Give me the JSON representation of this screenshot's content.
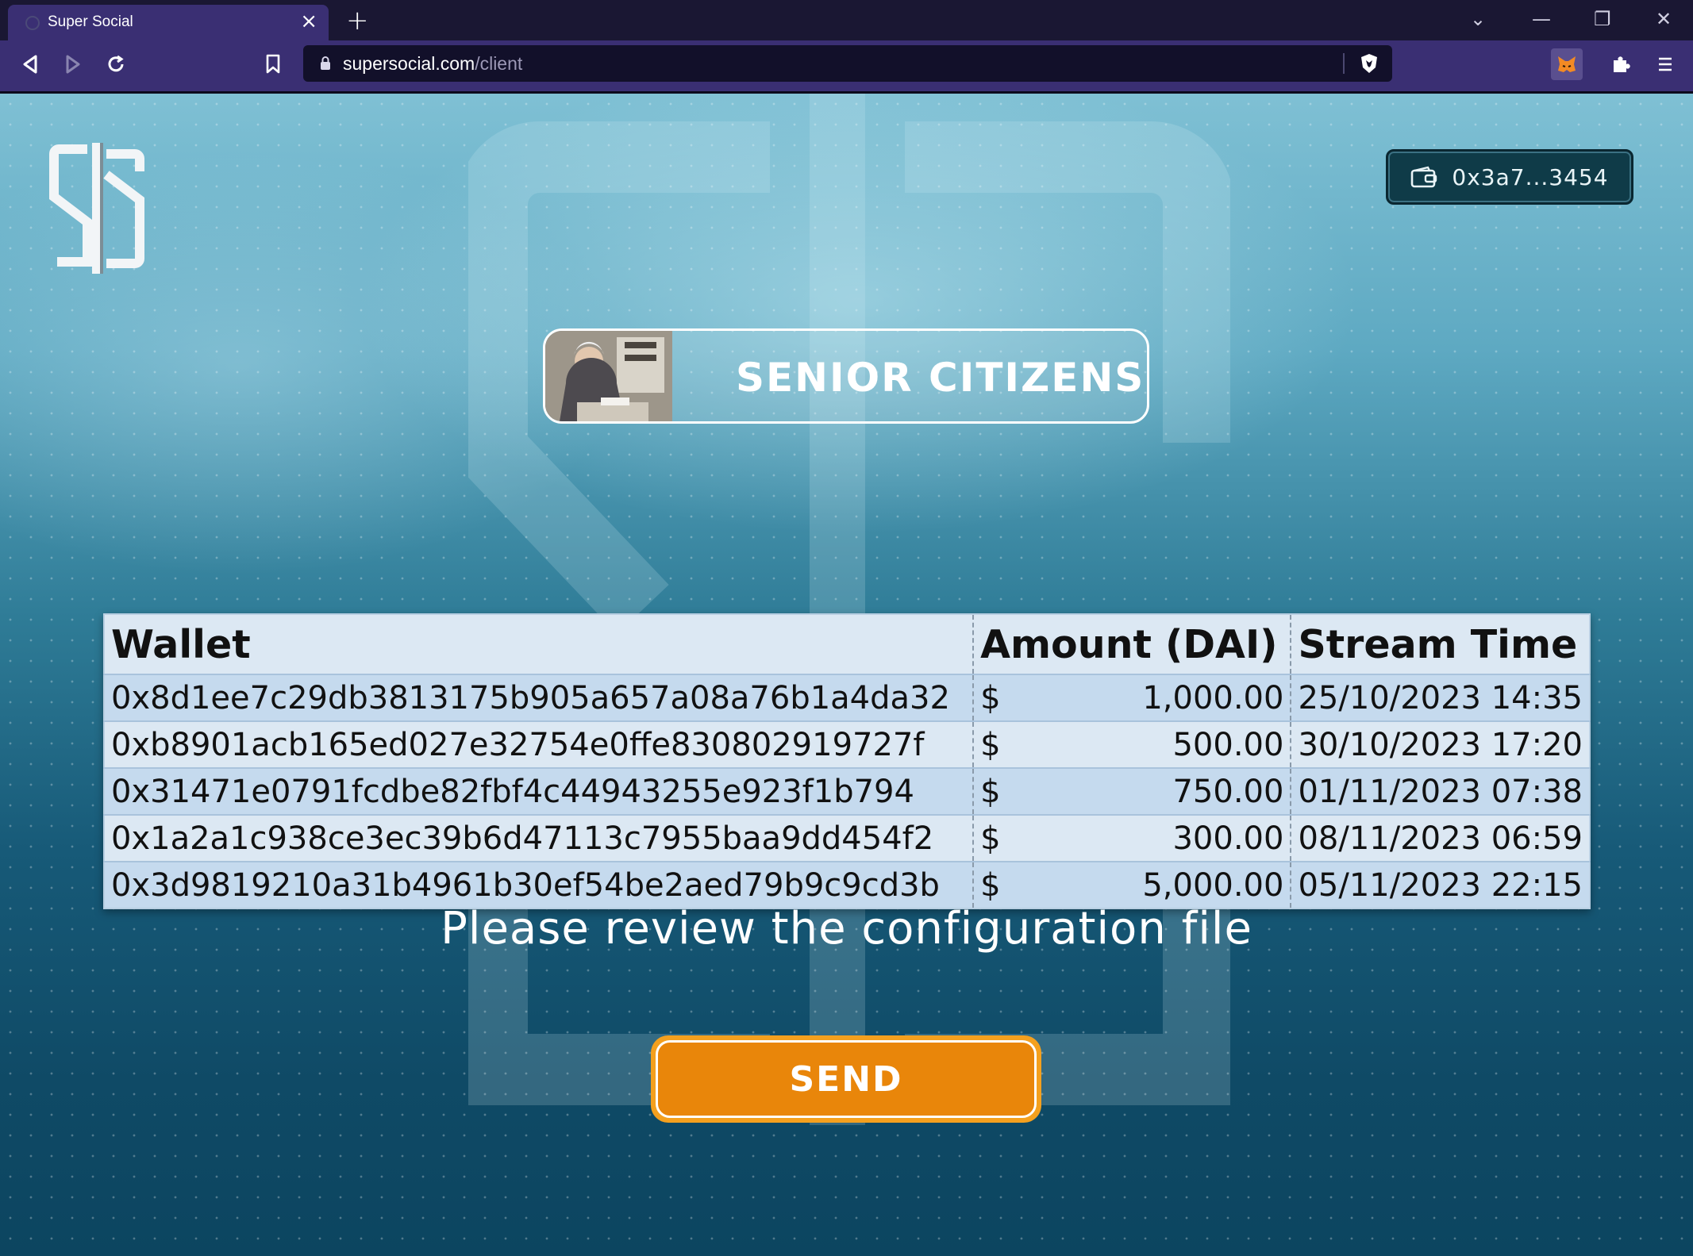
{
  "browser": {
    "tab_title": "Super Social",
    "url_host": "supersocial.com",
    "url_path": "/client"
  },
  "header": {
    "wallet_address": "0x3a7...3454"
  },
  "category": {
    "label": "SENIOR CITIZENS"
  },
  "table": {
    "headers": [
      "Wallet",
      "Amount (DAI)",
      "Stream Time"
    ],
    "currency_symbol": "$",
    "rows": [
      {
        "wallet": "0x8d1ee7c29db3813175b905a657a08a76b1a4da32",
        "amount": "1,000.00",
        "time": "25/10/2023 14:35"
      },
      {
        "wallet": "0xb8901acb165ed027e32754e0ffe830802919727f",
        "amount": "500.00",
        "time": "30/10/2023 17:20"
      },
      {
        "wallet": "0x31471e0791fcdbe82fbf4c44943255e923f1b794",
        "amount": "750.00",
        "time": "01/11/2023 07:38"
      },
      {
        "wallet": "0x1a2a1c938ce3ec39b6d47113c7955baa9dd454f2",
        "amount": "300.00",
        "time": "08/11/2023 06:59"
      },
      {
        "wallet": "0x3d9819210a31b4961b30ef54be2aed79b9c9cd3b",
        "amount": "5,000.00",
        "time": "05/11/2023 22:15"
      }
    ]
  },
  "message": "Please review the configuration file",
  "send_label": "SEND",
  "colors": {
    "browser_frame": "#3a2f73",
    "send_button": "#e9860a",
    "wallet_button": "#0f3b48"
  }
}
